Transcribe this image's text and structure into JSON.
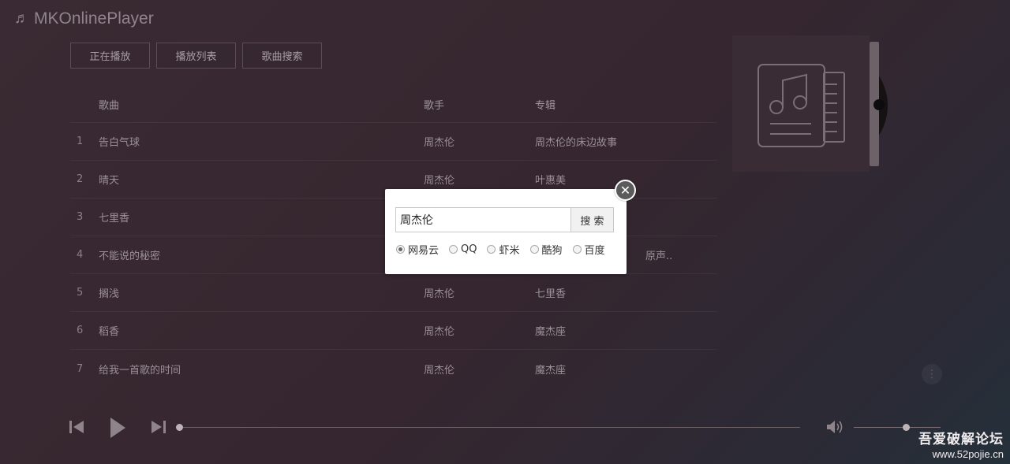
{
  "app": {
    "title": "MKOnlinePlayer",
    "note_glyph": "♬"
  },
  "tabs": [
    {
      "label": "正在播放"
    },
    {
      "label": "播放列表"
    },
    {
      "label": "歌曲搜索"
    }
  ],
  "list": {
    "headers": {
      "song": "歌曲",
      "artist": "歌手",
      "album": "专辑"
    },
    "rows": [
      {
        "num": "1",
        "song": "告白气球",
        "artist": "周杰伦",
        "album": "周杰伦的床边故事"
      },
      {
        "num": "2",
        "song": "晴天",
        "artist": "周杰伦",
        "album": "叶惠美"
      },
      {
        "num": "3",
        "song": "七里香",
        "artist": "",
        "album": ""
      },
      {
        "num": "4",
        "song": "不能说的秘密",
        "artist": "",
        "album": "原声.."
      },
      {
        "num": "5",
        "song": "搁浅",
        "artist": "周杰伦",
        "album": "七里香"
      },
      {
        "num": "6",
        "song": "稻香",
        "artist": "周杰伦",
        "album": "魔杰座"
      },
      {
        "num": "7",
        "song": "给我一首歌的时间",
        "artist": "周杰伦",
        "album": "魔杰座"
      }
    ]
  },
  "player": {
    "progress": 0.0,
    "volume": 0.57,
    "more_glyph": "⋮"
  },
  "dialog": {
    "search_value": "周杰伦",
    "search_button": "搜 索",
    "close_glyph": "✕",
    "sources": [
      {
        "label": "网易云",
        "checked": true
      },
      {
        "label": "QQ",
        "checked": false
      },
      {
        "label": "虾米",
        "checked": false
      },
      {
        "label": "酷狗",
        "checked": false
      },
      {
        "label": "百度",
        "checked": false
      }
    ]
  },
  "watermark": {
    "line1": "吾爱破解论坛",
    "line2": "www.52pojie.cn"
  }
}
